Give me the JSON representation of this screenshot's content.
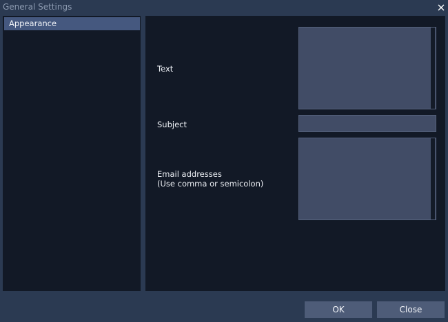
{
  "window": {
    "title": "General Settings"
  },
  "sidebar": {
    "items": [
      {
        "label": "Appearance",
        "selected": true
      }
    ]
  },
  "form": {
    "text_label": "Text",
    "text_value": "",
    "subject_label": "Subject",
    "subject_value": "",
    "email_label_line1": "Email addresses",
    "email_label_line2": "(Use comma or semicolon)",
    "email_value": ""
  },
  "buttons": {
    "ok_label": "OK",
    "close_label": "Close"
  },
  "colors": {
    "background": "#2b3a52",
    "panel": "#121926",
    "selected_item": "#45587f",
    "field": "#414c66",
    "button": "#4e5c78"
  }
}
